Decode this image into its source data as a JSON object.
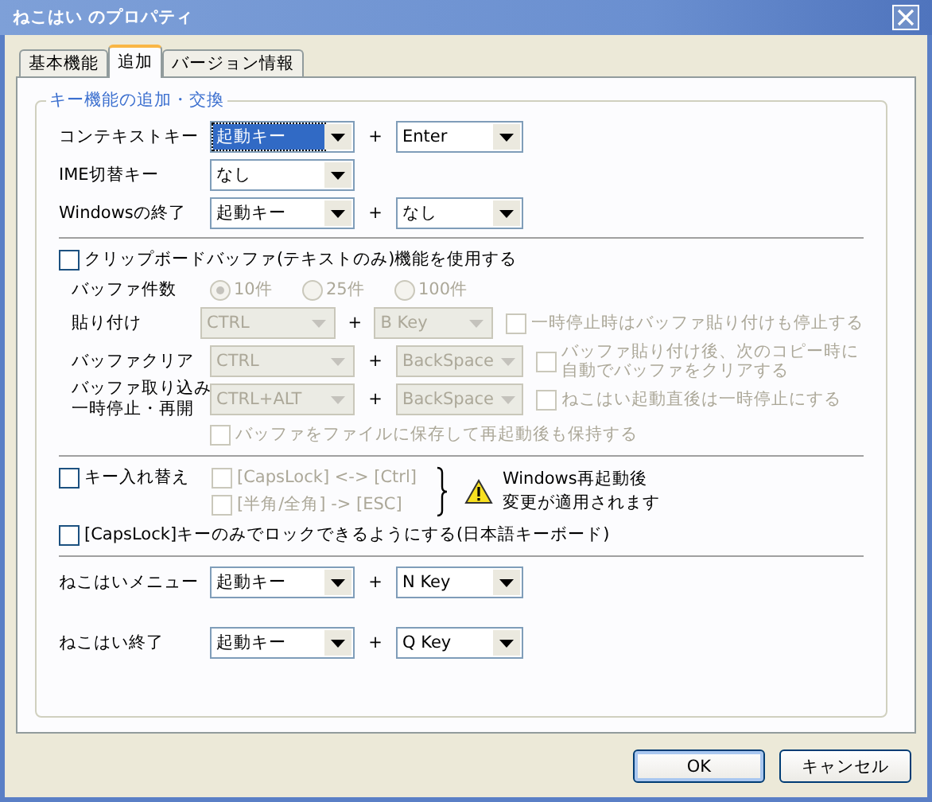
{
  "window": {
    "title": "ねこはい のプロパティ"
  },
  "tabs": [
    {
      "label": "基本機能",
      "selected": false
    },
    {
      "label": "追加",
      "selected": true
    },
    {
      "label": "バージョン情報",
      "selected": false
    }
  ],
  "group": {
    "title": "キー機能の追加・交換"
  },
  "key_rows": [
    {
      "label": "コンテキストキー",
      "key1": {
        "value": "起動キー",
        "focused": true
      },
      "plus": "+",
      "key2": {
        "value": "Enter",
        "focused": false
      }
    },
    {
      "label": "IME切替キー",
      "key1": {
        "value": "なし",
        "focused": false
      }
    },
    {
      "label": "Windowsの終了",
      "key1": {
        "value": "起動キー",
        "focused": false
      },
      "plus": "+",
      "key2": {
        "value": "なし",
        "focused": false
      }
    }
  ],
  "clipboard": {
    "label": "クリップボードバッファ(テキストのみ)機能を使用する",
    "checked": false,
    "count": {
      "label": "バッファ件数",
      "options": [
        {
          "label": "10件",
          "selected": true
        },
        {
          "label": "25件",
          "selected": false
        },
        {
          "label": "100件",
          "selected": false
        }
      ]
    },
    "rows": [
      {
        "lines": [
          "貼り付け"
        ],
        "key1": "CTRL",
        "plus": "+",
        "key2": "B Key",
        "option": {
          "lines": [
            "一時停止時はバッファ貼り付けも停止する"
          ],
          "checked": false
        }
      },
      {
        "lines": [
          "バッファクリア"
        ],
        "key1": "CTRL",
        "plus": "+",
        "key2": "BackSpace",
        "option": {
          "lines": [
            "バッファ貼り付け後、次のコピー時に",
            "自動でバッファをクリアする"
          ],
          "checked": false
        }
      },
      {
        "lines": [
          "バッファ取り込み",
          "一時停止・再開"
        ],
        "key1": "CTRL+ALT",
        "plus": "+",
        "key2": "BackSpace",
        "option": {
          "lines": [
            "ねこはい起動直後は一時停止にする"
          ],
          "checked": false
        }
      }
    ],
    "save_option": {
      "label": "バッファをファイルに保存して再起動後も保持する",
      "checked": false
    }
  },
  "key_swap": {
    "label": "キー入れ替え",
    "checked": false,
    "options": [
      {
        "label": "[CapsLock] <-> [Ctrl]",
        "checked": false
      },
      {
        "label": "[半角/全角] -> [ESC]",
        "checked": false
      }
    ],
    "notice": [
      "Windows再起動後",
      "変更が適用されます"
    ]
  },
  "capslock": {
    "label": "[CapsLock]キーのみでロックできるようにする(日本語キーボード)",
    "checked": false
  },
  "bottom_rows": [
    {
      "label": "ねこはいメニュー",
      "key1": {
        "value": "起動キー",
        "focused": false
      },
      "plus": "+",
      "key2": {
        "value": "N Key",
        "focused": false
      }
    },
    {
      "label": "ねこはい終了",
      "key1": {
        "value": "起動キー",
        "focused": false
      },
      "plus": "+",
      "key2": {
        "value": "Q Key",
        "focused": false
      }
    }
  ],
  "buttons": [
    {
      "label": "OK",
      "default": true
    },
    {
      "label": "キャンセル",
      "default": false
    }
  ]
}
